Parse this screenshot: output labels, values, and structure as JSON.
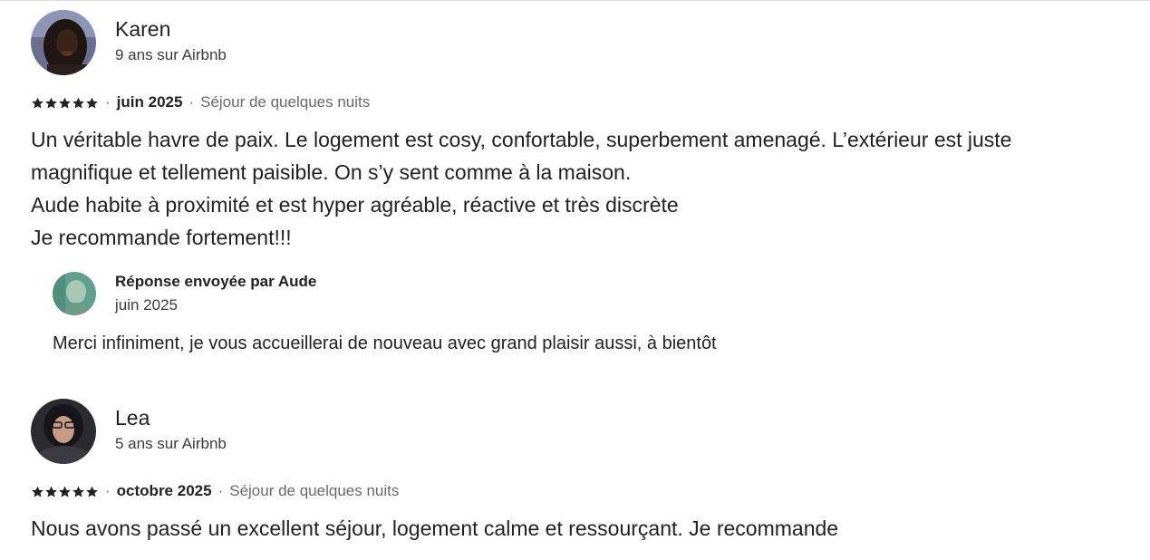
{
  "reviews": [
    {
      "name": "Karen",
      "tenure": "9 ans sur Airbnb",
      "rating": 5,
      "date": "juin 2025",
      "stay": "Séjour de quelques nuits",
      "separator": "·",
      "body": "Un véritable havre de paix. Le logement est cosy, confortable, superbement amenagé. L’extérieur est juste\nmagnifique et tellement paisible. On s’y sent comme à la maison.\nAude habite à proximité et est hyper agréable, réactive et très discrète\nJe recommande fortement!!!",
      "response": {
        "title": "Réponse envoyée par Aude",
        "date": "juin 2025",
        "body": "Merci infiniment, je vous accueillerai de nouveau avec grand plaisir aussi, à bientôt"
      }
    },
    {
      "name": "Lea",
      "tenure": "5 ans sur Airbnb",
      "rating": 5,
      "date": "octobre 2025",
      "stay": "Séjour de quelques nuits",
      "separator": "·",
      "body": "Nous avons passé un excellent séjour, logement calme et ressourçant. Je recommande"
    }
  ],
  "icons": {
    "star": "star-icon"
  },
  "colors": {
    "text": "#222222",
    "muted": "#6a6a6a",
    "divider": "#dddddd"
  }
}
